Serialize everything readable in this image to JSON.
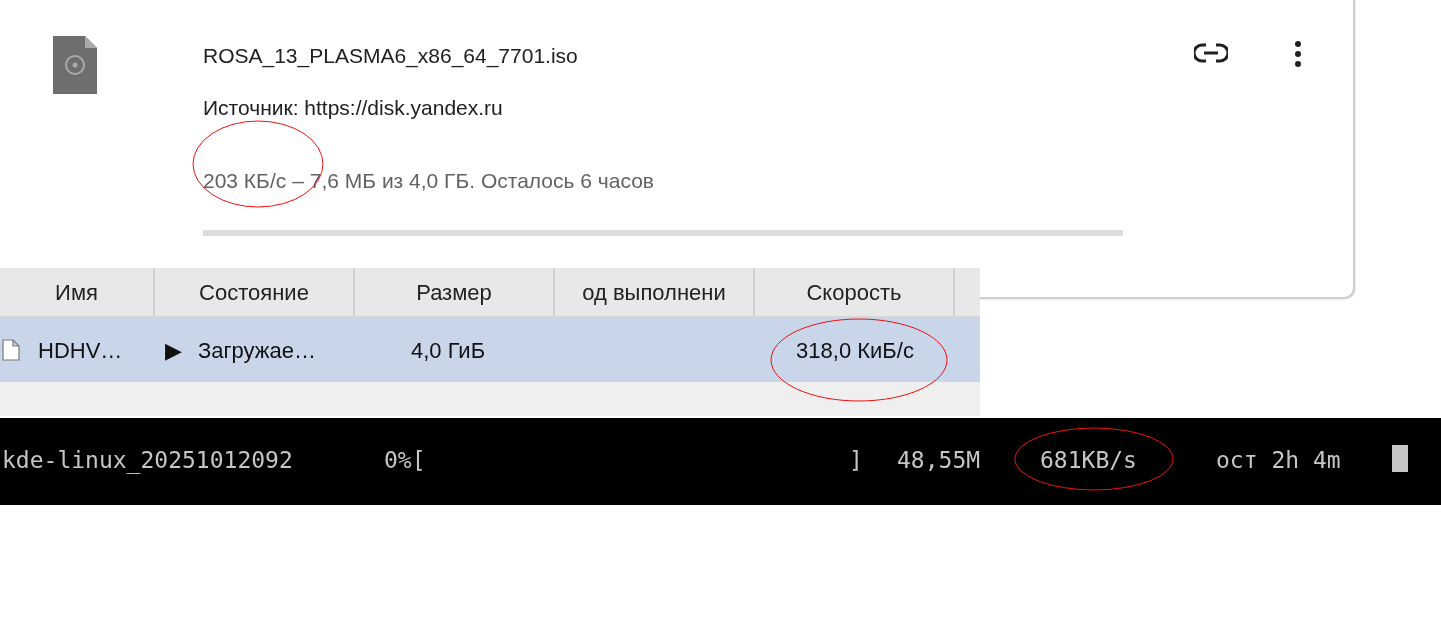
{
  "browser_download": {
    "file_name": "ROSA_13_PLASMA6_x86_64_7701.iso",
    "source": "Источник: https://disk.yandex.ru",
    "speed": {
      "text": "203 КБ/с",
      "circled": true
    },
    "progress_text": "– 7,6 МБ из 4,0 ГБ. Осталось 6 часов"
  },
  "download_manager": {
    "columns": [
      "Имя",
      "Состояние",
      "Размер",
      "од выполнени",
      "Скорость"
    ],
    "rows": [
      {
        "name": "HDHV…",
        "state": "Загружае…",
        "state_icon": "▶",
        "size": "4,0 ГиБ",
        "progress": "",
        "speed": {
          "text": "318,0 КиБ/с",
          "circled": true
        },
        "selected": true
      }
    ]
  },
  "terminal": {
    "file": "kde-linux_20251012092",
    "percent": "0%[",
    "bar_end": "]",
    "downloaded": "48,55M",
    "speed": {
      "text": "681KB/s",
      "circled": true
    },
    "eta": "ост 2h 4m"
  }
}
